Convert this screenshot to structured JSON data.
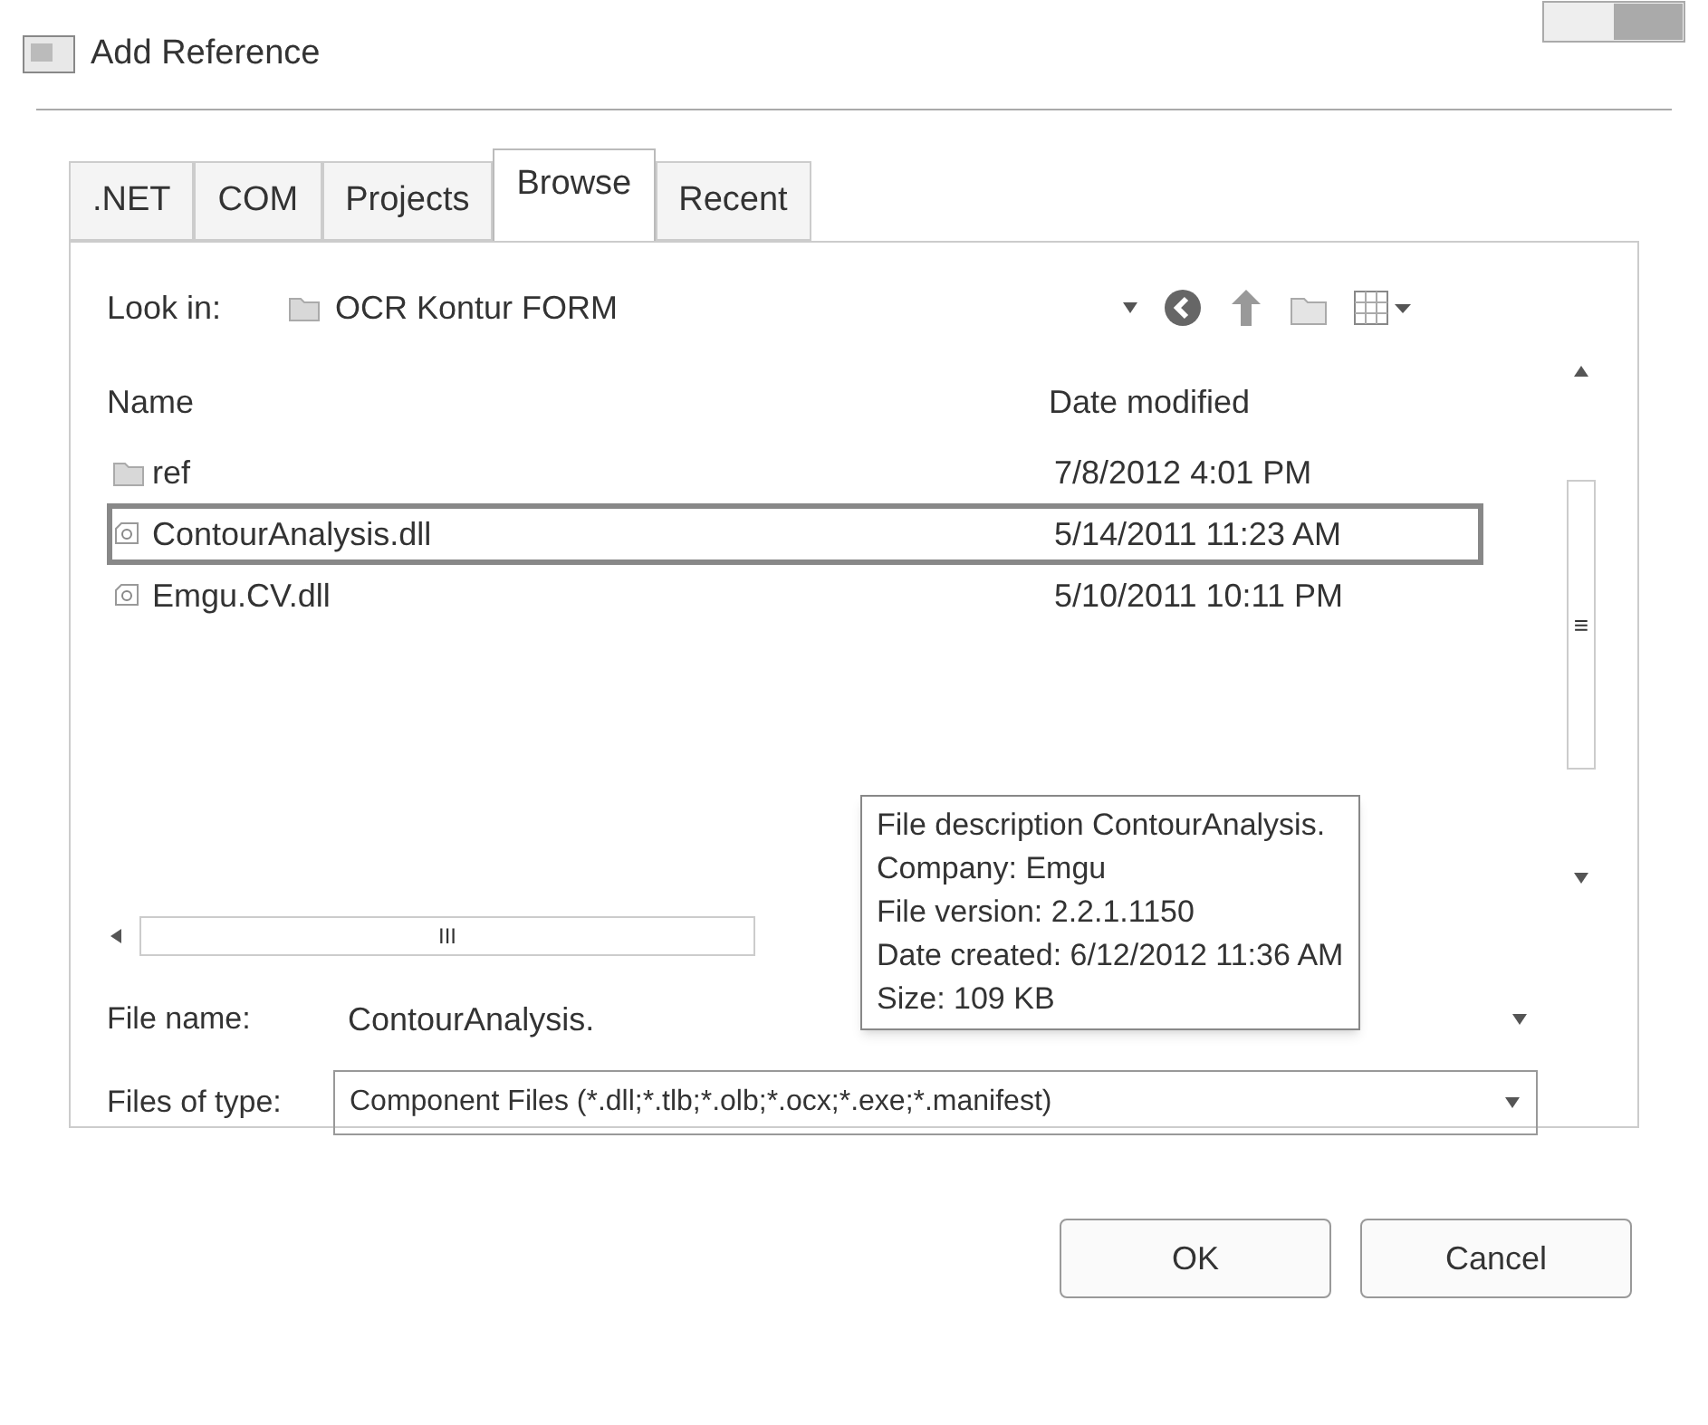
{
  "window": {
    "title": "Add Reference"
  },
  "tabs": [
    {
      "label": ".NET",
      "selected": false
    },
    {
      "label": "COM",
      "selected": false
    },
    {
      "label": "Projects",
      "selected": false
    },
    {
      "label": "Browse",
      "selected": true
    },
    {
      "label": "Recent",
      "selected": false
    }
  ],
  "look_in": {
    "label": "Look in:",
    "value": "OCR Kontur FORM"
  },
  "file_list": {
    "columns": [
      "Name",
      "Date modified"
    ],
    "rows": [
      {
        "kind": "folder",
        "name": "ref",
        "date": "7/8/2012 4:01 PM",
        "selected": false
      },
      {
        "kind": "file",
        "name": "ContourAnalysis.dll",
        "date": "5/14/2011 11:23 AM",
        "selected": true
      },
      {
        "kind": "file",
        "name": "Emgu.CV.dll",
        "date": "5/10/2011 10:11 PM",
        "selected": false
      }
    ],
    "hscroll_grip": "III",
    "vscroll_grip": "≡"
  },
  "tooltip": [
    "File description ContourAnalysis.",
    "Company: Emgu",
    "File version: 2.2.1.1150",
    "Date created: 6/12/2012 11:36 AM",
    "Size: 109 KB"
  ],
  "file_name": {
    "label": "File name:",
    "value": "ContourAnalysis."
  },
  "files_of_type": {
    "label": "Files of type:",
    "value": "Component Files (*.dll;*.tlb;*.olb;*.ocx;*.exe;*.manifest)"
  },
  "buttons": [
    "OK",
    "Cancel"
  ]
}
